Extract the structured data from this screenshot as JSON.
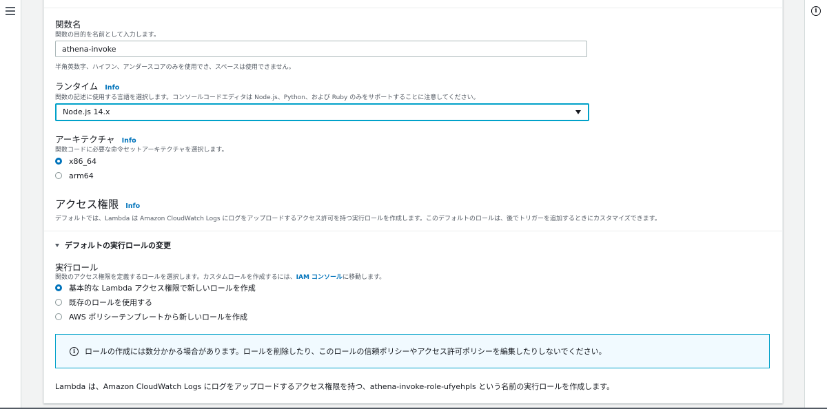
{
  "function_name": {
    "label": "関数名",
    "description": "関数の目的を名前として入力します。",
    "value": "athena-invoke",
    "constraint": "半角英数字、ハイフン、アンダースコアのみを使用でき、スペースは使用できません。"
  },
  "runtime": {
    "label": "ランタイム",
    "info": "Info",
    "description": "関数の記述に使用する言語を選択します。コンソールコードエディタは Node.js、Python、および Ruby のみをサポートすることに注意してください。",
    "selected": "Node.js 14.x"
  },
  "architecture": {
    "label": "アーキテクチャ",
    "info": "Info",
    "description": "関数コードに必要な命令セットアーキテクチャを選択します。",
    "options": [
      {
        "label": "x86_64",
        "checked": true
      },
      {
        "label": "arm64",
        "checked": false
      }
    ]
  },
  "permissions": {
    "title": "アクセス権限",
    "info": "Info",
    "description": "デフォルトでは、Lambda は Amazon CloudWatch Logs にログをアップロードするアクセス許可を持つ実行ロールを作成します。このデフォルトのロールは、後でトリガーを追加するときにカスタマイズできます。"
  },
  "expander": {
    "label": "デフォルトの実行ロールの変更"
  },
  "execution_role": {
    "label": "実行ロール",
    "description_prefix": "関数のアクセス権限を定義するロールを選択します。カスタムロールを作成するには、",
    "iam_link": "IAM コンソール",
    "description_suffix": "に移動します。",
    "options": [
      {
        "label": "基本的な Lambda アクセス権限で新しいロールを作成",
        "checked": true
      },
      {
        "label": "既存のロールを使用する",
        "checked": false
      },
      {
        "label": "AWS ポリシーテンプレートから新しいロールを作成",
        "checked": false
      }
    ]
  },
  "alert": {
    "text": "ロールの作成には数分かかる場合があります。ロールを削除したり、このロールの信頼ポリシーやアクセス許可ポリシーを編集したりしないでください。"
  },
  "footer": {
    "text": "Lambda は、Amazon CloudWatch Logs にログをアップロードするアクセス権限を持つ、athena-invoke-role-ufyehpls という名前の実行ロールを作成します。"
  },
  "icons": {
    "menu": "hamburger-menu-icon",
    "info": "info-circle-icon",
    "select_caret": "caret-down-icon",
    "expander_caret": "caret-expanded-icon"
  },
  "colors": {
    "link": "#0073bb",
    "focus_border": "#00a1c9",
    "alert_background": "#f1faff"
  }
}
